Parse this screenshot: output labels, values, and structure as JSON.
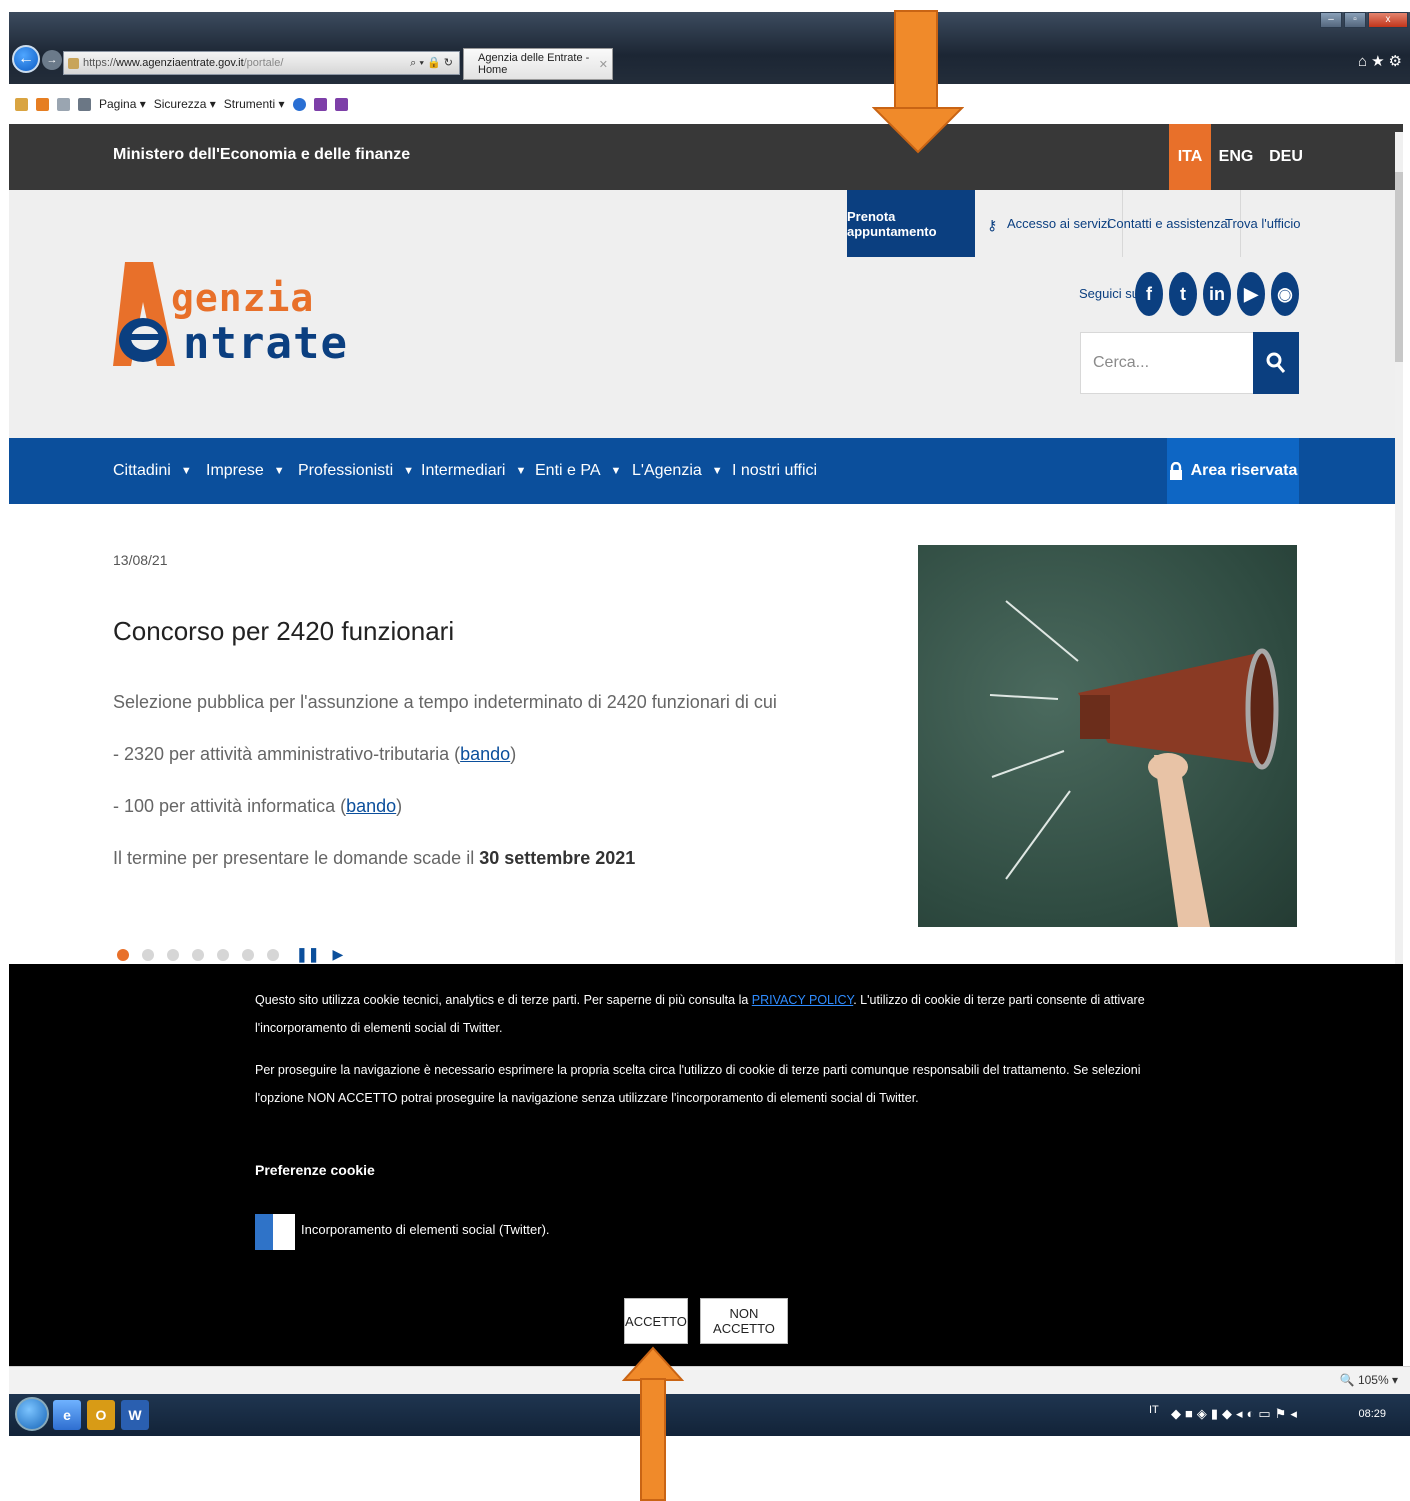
{
  "browser": {
    "url_prefix": "https://",
    "url_domain": "www.agenziaentrate.gov.it",
    "url_path": "/portale/",
    "tab_title": "Agenzia delle Entrate - Home",
    "command_bar": {
      "page": "Pagina ▾",
      "security": "Sicurezza ▾",
      "tools": "Strumenti ▾"
    },
    "zoom": "105%"
  },
  "site": {
    "ministry": "Ministero dell'Economia e delle finanze",
    "languages": [
      "ITA",
      "ENG",
      "DEU"
    ],
    "active_language": "ITA",
    "top_links": {
      "prenota": "Prenota appuntamento",
      "accesso": "Accesso ai servizi",
      "contatti": "Contatti e assistenza",
      "trova": "Trova l'ufficio"
    },
    "logo": {
      "line1": "genzia",
      "line2": "ntrate"
    },
    "follow_label": "Seguici su:",
    "search": {
      "placeholder": "Cerca..."
    },
    "nav": {
      "items": [
        {
          "label": "Cittadini",
          "caret": "▼"
        },
        {
          "label": "Imprese",
          "caret": "▼"
        },
        {
          "label": "Professionisti",
          "caret": "▼"
        },
        {
          "label": "Intermediari",
          "caret": "▼"
        },
        {
          "label": "Enti e PA",
          "caret": "▼"
        },
        {
          "label": "L'Agenzia",
          "caret": "▼"
        },
        {
          "label": "I nostri uffici",
          "caret": ""
        }
      ],
      "area_riservata": "Area riservata"
    },
    "news": {
      "date": "13/08/21",
      "title": "Concorso per 2420 funzionari",
      "line1": "Selezione pubblica per l'assunzione a tempo indeterminato di 2420 funzionari di cui",
      "line2_text": "- 2320 per attività amministrativo-tributaria (",
      "line2_link": "bando",
      "line2_end": ")",
      "line3_text": "- 100 per attività informatica (",
      "line3_link": "bando",
      "line3_end": ")",
      "line4_text": "Il termine per presentare le domande scade il ",
      "line4_bold": "30 settembre 2021"
    },
    "carousel": {
      "total": 7,
      "active_index": 0
    }
  },
  "cookie_banner": {
    "p1_before": "Questo sito utilizza cookie tecnici, analytics e di terze parti. Per saperne di più consulta la ",
    "p1_link": "PRIVACY POLICY",
    "p1_after": ". L'utilizzo di cookie di terze parti consente di attivare l'incorporamento di elementi social di Twitter.",
    "p2": "Per proseguire la navigazione è necessario esprimere la propria scelta circa l'utilizzo di cookie di terze parti comunque responsabili del trattamento. Se selezioni l'opzione NON ACCETTO potrai proseguire la navigazione senza utilizzare l'incorporamento di elementi social di Twitter.",
    "preferences_title": "Preferenze cookie",
    "toggle_label": "Incorporamento di elementi social (Twitter).",
    "accept": "ACCETTO",
    "reject": "NON ACCETTO"
  },
  "taskbar": {
    "lang": "IT",
    "clock": "08:29"
  },
  "colors": {
    "orange": "#e8702a",
    "blue_dark": "#0b3f80",
    "blue_nav": "#0b4f9c",
    "arrow": "#f08a2a"
  }
}
